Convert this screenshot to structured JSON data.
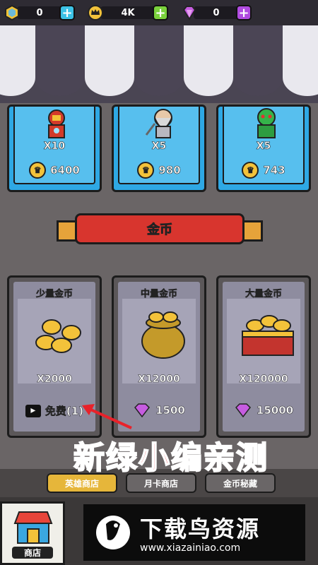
{
  "currencies": [
    {
      "icon": "gem-gold-icon",
      "value": "0",
      "plus_color": "#3cc2e6"
    },
    {
      "icon": "crown-coin-icon",
      "value": "4K",
      "plus_color": "#7ad13c"
    },
    {
      "icon": "diamond-icon",
      "value": "0",
      "plus_color": "#b04be0"
    }
  ],
  "heroes": [
    {
      "qty": "X10",
      "price": "6400"
    },
    {
      "qty": "X5",
      "price": "980"
    },
    {
      "qty": "X5",
      "price": "743"
    }
  ],
  "section_title": "金币",
  "coin_packs": [
    {
      "title": "少量金币",
      "qty": "X2000",
      "price": "免费(1)",
      "price_type": "ad"
    },
    {
      "title": "中量金币",
      "qty": "X12000",
      "price": "1500",
      "price_type": "gem"
    },
    {
      "title": "大量金币",
      "qty": "X120000",
      "price": "15000",
      "price_type": "gem"
    }
  ],
  "tabs": [
    "英雄商店",
    "月卡商店",
    "金币秘藏"
  ],
  "bottom_nav": {
    "shop_label": "商店"
  },
  "watermark": {
    "line1": "新绿小编亲测",
    "logo_text": "下载鸟资源",
    "logo_url": "www.xiazainiao.com"
  },
  "colors": {
    "accent_red": "#d8352e",
    "hero_blue": "#2ea8e4",
    "gold": "#f3c23a"
  }
}
